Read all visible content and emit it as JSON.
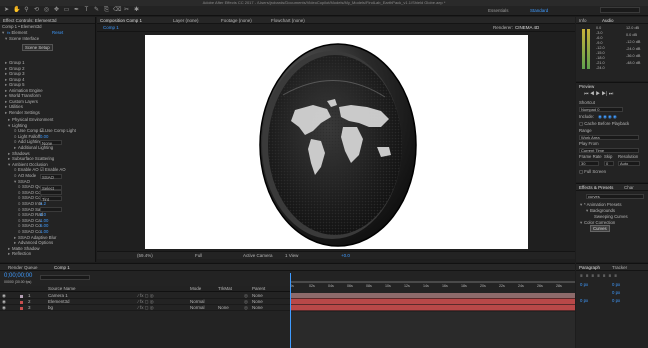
{
  "app": {
    "title": "Adobe After Effects CC 2017 - /Users/jrobards/Documents/VideoCopilot/Models/My_Models/FindLab_EarthPack_v1.1/Shield Globe.aep *"
  },
  "toolbar": {
    "tools": [
      "arrow-icon",
      "hand-icon",
      "zoom-icon",
      "rotate-icon",
      "camera-orbit-icon",
      "pan-behind-icon",
      "rect-mask-icon",
      "pen-icon",
      "type-icon",
      "brush-icon",
      "clone-icon",
      "eraser-icon",
      "roto-icon",
      "puppet-icon"
    ],
    "workspaces": [
      "Essentials",
      "Standard"
    ],
    "search_label": "Search Help"
  },
  "effect_controls": {
    "tab": "Effect Controls: Element3d",
    "comp_path": "Comp 1 • Element3d",
    "effect_name": "Element",
    "reset": "Reset",
    "scene_interface": "Scene Interface",
    "scene_setup": "Scene Setup",
    "groups": [
      "Group 1",
      "Group 2",
      "Group 3",
      "Group 4",
      "Group 5"
    ],
    "items": [
      "Animation Engine",
      "World Transform",
      "Custom Layers",
      "Utilities",
      "Render Settings"
    ],
    "render": {
      "physical_env": "Physical Environment",
      "lighting": "Lighting",
      "use_comp_lights": "Use Comp Li...",
      "use_comp_lights_check": "Use Comp Light",
      "light_falloff": "Light Falloff",
      "light_falloff_val": "0.00",
      "add_lighting": "Add Lighting",
      "add_lighting_val": "None",
      "additional_lighting": "Additional Lighting",
      "shadows": "Shadows",
      "subsurface": "Subsurface Scattering",
      "ambient_occlusion": "Ambient Occlusion",
      "enable_ao": "Enable AO",
      "enable_ao_check": "Enable AO",
      "ao_mode": "AO Mode",
      "ao_mode_val": "SSAO",
      "ssao": "SSAO",
      "ssao_quality": "SSAO Qua",
      "ssao_quality_val": "Select",
      "ssao_col": "SSAO Col",
      "ssao_col_val": "",
      "ssao_col2": "SSAO Col",
      "ssao_col2_val": "Tint",
      "ssao_inte": "SSAO Inte",
      "ssao_inte_val": "1.2",
      "ssao_sa": "SSAO Sa",
      "ssao_sa_val": "",
      "ssao_rad": "SSAO Rad",
      "ssao_rad_val": "5.0",
      "ssao_ca": "SSAO Ca",
      "ssao_ca_val": "1.00",
      "ssao_cs": "SSAO Co",
      "ssao_cs_val": "5.00",
      "ssao_co": "SSAO Co",
      "ssao_co_val": "1.00",
      "ssao_adaptive": "SSAO Adaptive Blur",
      "advanced": "Advanced Options",
      "matte_shadow": "Matte Shadow",
      "reflection": "Reflection"
    }
  },
  "composition": {
    "tabs": [
      "Composition Comp 1",
      "Layer (none)",
      "Footage (none)",
      "Flowchart (none)"
    ],
    "subtab": "Comp 1",
    "renderer_label": "Renderer:",
    "renderer_value": "CINEMA 4D",
    "zoom": "(59.4%)",
    "resolution": "Full",
    "camera": "Active Camera",
    "view": "1 View",
    "exposure": "+0.0"
  },
  "info": {
    "tab_info": "Info",
    "tab_audio": "Audio",
    "levels_left": [
      "0.0",
      "-3.0",
      "-6.0",
      "-9.0",
      "-12.0",
      "-15.0",
      "-18.0",
      "-21.0",
      "-24.0"
    ],
    "levels_right": [
      "12.0 dB",
      "0.0 dB",
      "-12.0 dB",
      "-24.0 dB",
      "-36.0 dB",
      "-48.0 dB"
    ]
  },
  "preview": {
    "title": "Preview",
    "shortcut_label": "Shortcut",
    "shortcut_value": "Numpad 0",
    "include_label": "Include:",
    "cache_label": "Cache Before Playback",
    "range_label": "Range",
    "range_value": "Work Area",
    "play_from_label": "Play From",
    "play_from_value": "Current Time",
    "frame_rate_label": "Frame Rate",
    "skip_label": "Skip",
    "resolution_label": "Resolution",
    "frame_rate_value": "30",
    "skip_value": "0",
    "resolution_value": "Auto",
    "full_screen_label": "Full Screen"
  },
  "effects_presets": {
    "tab": "Effects & Presets",
    "tab2": "Char",
    "search_value": "curves",
    "tree": [
      "* Animation Presets",
      "Backgrounds",
      "Sweeping Curves",
      "Color Correction",
      "Curves"
    ]
  },
  "timeline": {
    "tabs": [
      "Render Queue",
      "Comp 1"
    ],
    "timecode": "0;00;00;00",
    "fps_text": "00000 (30.00 fps)",
    "columns": {
      "source": "Source Name",
      "mode": "Mode",
      "trkmat": "TrkMat",
      "parent": "Parent"
    },
    "layers": [
      {
        "num": "1",
        "name": "Camera 1",
        "color": "#b5a0b5",
        "mode": "",
        "trkmat": "",
        "parent": "None"
      },
      {
        "num": "2",
        "name": "Element3d",
        "color": "#c94e4e",
        "mode": "Normal",
        "trkmat": "",
        "parent": "None"
      },
      {
        "num": "3",
        "name": "bg",
        "color": "#c94e4e",
        "mode": "Normal",
        "trkmat": "None",
        "parent": "None"
      }
    ],
    "ruler_labels": [
      "0s",
      "02s",
      "04s",
      "06s",
      "08s",
      "10s",
      "12s",
      "14s",
      "16s",
      "18s",
      "20s",
      "22s",
      "24s",
      "26s",
      "28s"
    ]
  },
  "paragraph": {
    "tab": "Paragraph",
    "tab2": "Tracker",
    "fields": [
      "0 px",
      "0 px",
      "0 px",
      "0 px",
      "0 px"
    ]
  },
  "colors": {
    "accent": "#3f9bff",
    "layer_bar": "#b84848",
    "camera_bar": "#8d6a6a",
    "globe_dark": "#1a1a1a"
  }
}
